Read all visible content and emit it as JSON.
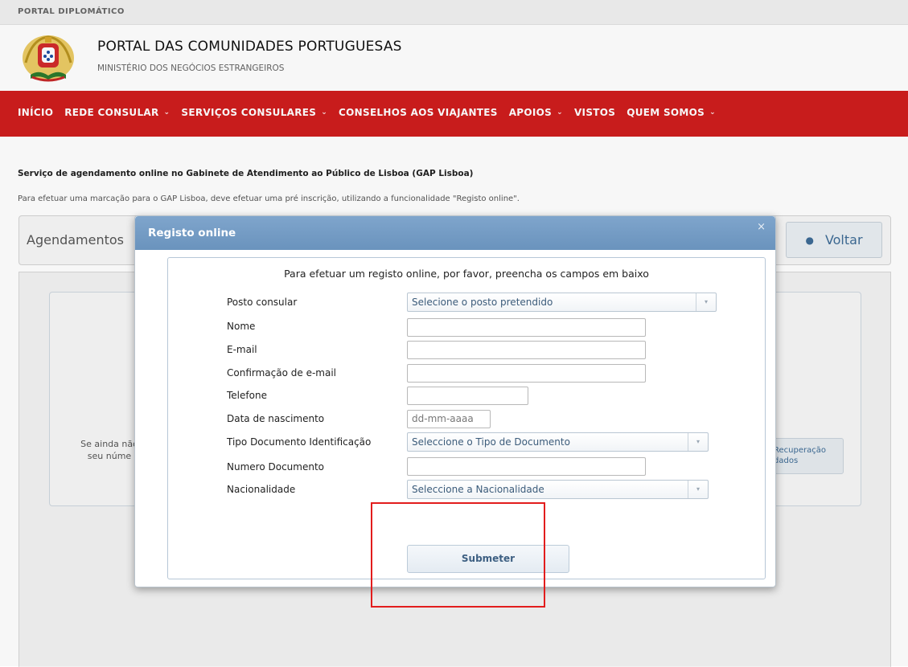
{
  "topbar": {
    "label": "PORTAL DIPLOMÁTICO"
  },
  "header": {
    "title": "PORTAL DAS COMUNIDADES PORTUGUESAS",
    "subtitle": "MINISTÉRIO DOS NEGÓCIOS ESTRANGEIROS",
    "logo_icon": "portugal-coat-of-arms-icon"
  },
  "nav": {
    "items": [
      {
        "label": "INÍCIO",
        "dropdown": false
      },
      {
        "label": "REDE CONSULAR",
        "dropdown": true
      },
      {
        "label": "SERVIÇOS CONSULARES",
        "dropdown": true
      },
      {
        "label": "CONSELHOS AOS VIAJANTES",
        "dropdown": false
      },
      {
        "label": "APOIOS",
        "dropdown": true
      },
      {
        "label": "VISTOS",
        "dropdown": false
      },
      {
        "label": "QUEM SOMOS",
        "dropdown": true
      }
    ],
    "chevron": "⌄",
    "color": "#cf1d1d"
  },
  "page": {
    "heading": "Serviço de agendamento online no Gabinete de Atendimento ao Público de Lisboa (GAP Lisboa)",
    "description": "Para efetuar uma marcação para o GAP Lisboa, deve efetuar uma pré inscrição, utilizando a funcionalidade \"Registo online\".",
    "panel_title": "Agendamentos",
    "back_button": "Voltar",
    "bg_text_line1": "Se ainda não",
    "bg_text_line2": "seu núme",
    "bg_button_line1": "Recuperação",
    "bg_button_line2": "dados"
  },
  "modal": {
    "title": "Registo online",
    "close": "×",
    "intro": "Para efetuar um registo online, por favor, preencha os campos em baixo",
    "fields": {
      "posto": {
        "label": "Posto consular",
        "value": "Selecione o posto pretendido"
      },
      "nome": {
        "label": "Nome",
        "value": ""
      },
      "email": {
        "label": "E-mail",
        "value": ""
      },
      "email_conf": {
        "label": "Confirmação de e-mail",
        "value": ""
      },
      "telefone": {
        "label": "Telefone",
        "value": ""
      },
      "nascimento": {
        "label": "Data de nascimento",
        "placeholder": "dd-mm-aaaa"
      },
      "tipo_doc": {
        "label": "Tipo Documento Identificação",
        "value": "Seleccione o Tipo de Documento"
      },
      "num_doc": {
        "label": "Numero Documento",
        "value": ""
      },
      "nacionalidade": {
        "label": "Nacionalidade",
        "value": "Seleccione a Nacionalidade"
      }
    },
    "submit": "Submeter",
    "select_arrow": "▾",
    "header_color": "#7099c3"
  },
  "highlight": {
    "color": "#e21d1d"
  }
}
